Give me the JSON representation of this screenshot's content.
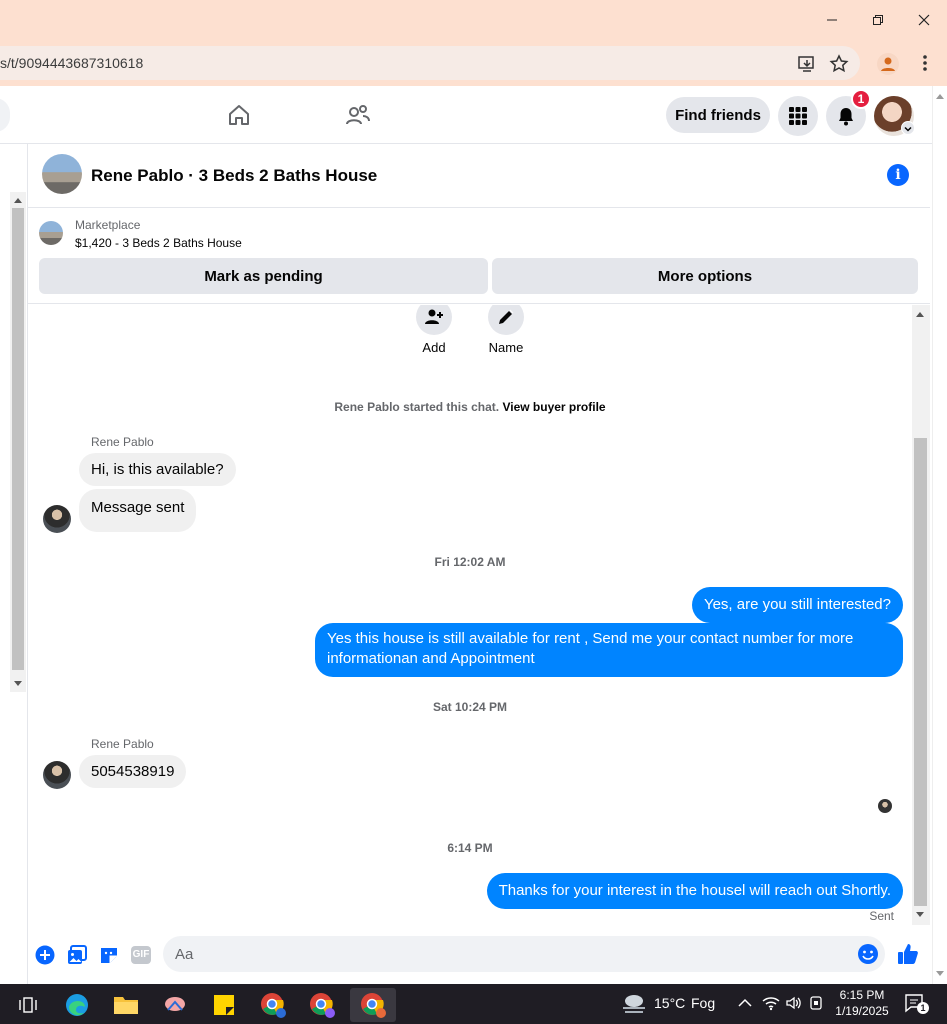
{
  "browser": {
    "url": "s/t/9094443687310618",
    "window_controls": {
      "minimize": "—",
      "restore": "❐",
      "close": "✕"
    }
  },
  "nav": {
    "find_friends": "Find friends",
    "notification_count": "1"
  },
  "chat_header": {
    "title": "Rene Pablo · 3 Beds 2 Baths House"
  },
  "marketplace": {
    "label": "Marketplace",
    "listing": "$1,420 - 3 Beds 2 Baths House",
    "mark_pending": "Mark as pending",
    "more_options": "More options"
  },
  "actions": {
    "add": "Add",
    "name": "Name"
  },
  "chat": {
    "started_text": "Rene Pablo started this chat.",
    "view_profile": "View buyer profile",
    "sender": "Rene Pablo",
    "msg1": "Hi, is this available?",
    "msg2": "Message sent",
    "ts1": "Fri 12:02 AM",
    "out1": "Yes, are you still interested?",
    "out2": "Yes this house is still available for rent , Send me your contact number for more informationan and Appointment",
    "ts2": "Sat 10:24 PM",
    "sender2": "Rene Pablo",
    "msg3": "5054538919",
    "ts3": "6:14 PM",
    "out3": "Thanks for your interest in the housel will reach out Shortly.",
    "sent_status": "Sent"
  },
  "composer": {
    "placeholder": "Aa",
    "gif": "GIF"
  },
  "taskbar": {
    "temperature": "15°C",
    "weather": "Fog",
    "time": "6:15 PM",
    "date": "1/19/2025",
    "notif_count": "1"
  },
  "colors": {
    "accent": "#0084ff",
    "fb_blue": "#0866ff",
    "badge_red": "#e41e3f",
    "titlebar": "#fde0d0"
  }
}
